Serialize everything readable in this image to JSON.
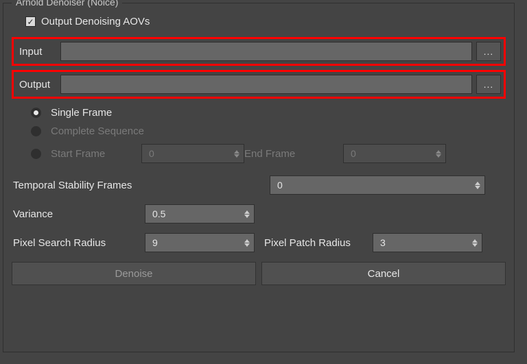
{
  "panel": {
    "title": "Arnold Denoiser (Noice)"
  },
  "checkbox": {
    "output_aovs_label": "Output Denoising AOVs",
    "output_aovs_checked": true
  },
  "input": {
    "label": "Input",
    "value": "",
    "browse": "..."
  },
  "output": {
    "label": "Output",
    "value": "",
    "browse": "..."
  },
  "mode": {
    "single_label": "Single Frame",
    "sequence_label": "Complete Sequence",
    "start_label": "Start Frame",
    "end_label": "End Frame",
    "start_value": "0",
    "end_value": "0"
  },
  "params": {
    "temporal_label": "Temporal Stability Frames",
    "temporal_value": "0",
    "variance_label": "Variance",
    "variance_value": "0.5",
    "search_label": "Pixel Search Radius",
    "search_value": "9",
    "patch_label": "Pixel Patch Radius",
    "patch_value": "3"
  },
  "buttons": {
    "denoise": "Denoise",
    "cancel": "Cancel"
  }
}
